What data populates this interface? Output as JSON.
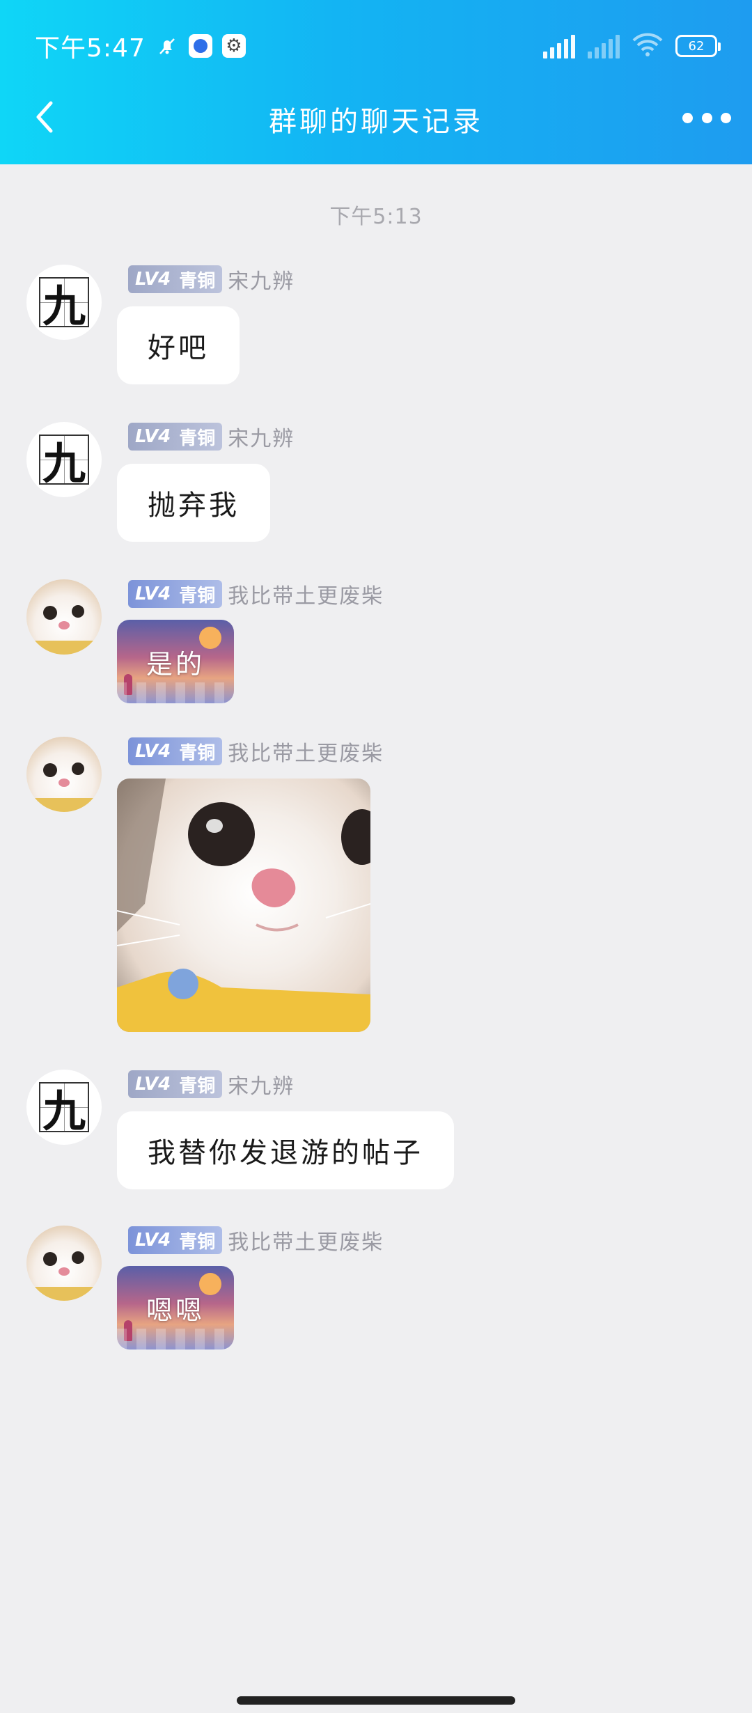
{
  "status_bar": {
    "time": "下午5:47",
    "battery": "62",
    "icons": [
      "mute-bell-icon",
      "app-notification-icon",
      "settings-gear-icon",
      "signal-icon",
      "signal-icon",
      "wifi-icon",
      "battery-icon"
    ]
  },
  "nav": {
    "title": "群聊的聊天记录",
    "back_icon": "chevron-left-icon",
    "more_icon": "more-dots-icon"
  },
  "chat": {
    "timestamp": "下午5:13",
    "messages": [
      {
        "sender": "宋九辨",
        "level": "LV4",
        "rank": "青铜",
        "avatar": "jiu-char",
        "avatar_text": "九",
        "type": "text",
        "content": "好吧"
      },
      {
        "sender": "宋九辨",
        "level": "LV4",
        "rank": "青铜",
        "avatar": "jiu-char",
        "avatar_text": "九",
        "type": "text",
        "content": "抛弃我"
      },
      {
        "sender": "我比带土更废柴",
        "level": "LV4",
        "rank": "青铜",
        "avatar": "cat",
        "type": "sticker",
        "content": "是的"
      },
      {
        "sender": "我比带土更废柴",
        "level": "LV4",
        "rank": "青铜",
        "avatar": "cat",
        "type": "image",
        "content": "cat-photo"
      },
      {
        "sender": "宋九辨",
        "level": "LV4",
        "rank": "青铜",
        "avatar": "jiu-char",
        "avatar_text": "九",
        "type": "text",
        "content": "我替你发退游的帖子"
      },
      {
        "sender": "我比带土更废柴",
        "level": "LV4",
        "rank": "青铜",
        "avatar": "cat",
        "type": "sticker",
        "content": "嗯嗯"
      }
    ]
  },
  "colors": {
    "header_start": "#0fd6f7",
    "header_end": "#1e9cf0",
    "chat_bg": "#efeff1",
    "bubble_bg": "#ffffff"
  }
}
